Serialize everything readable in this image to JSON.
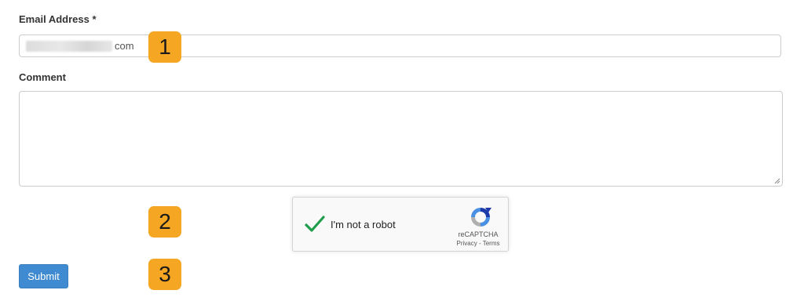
{
  "form": {
    "email": {
      "label": "Email Address *",
      "value_suffix": "com"
    },
    "comment": {
      "label": "Comment",
      "value": ""
    },
    "recaptcha": {
      "checkbox_label": "I'm not a robot",
      "checked": true,
      "brand": "reCAPTCHA",
      "privacy_label": "Privacy",
      "separator": " - ",
      "terms_label": "Terms",
      "check_color": "#1e9e4a",
      "icon": "recaptcha-logo-icon"
    },
    "submit_label": "Submit"
  },
  "annotations": {
    "step1": "1",
    "step2": "2",
    "step3": "3",
    "badge_color": "#f5a623"
  },
  "colors": {
    "submit_bg": "#3f8ad0",
    "input_border": "#cccccc"
  }
}
